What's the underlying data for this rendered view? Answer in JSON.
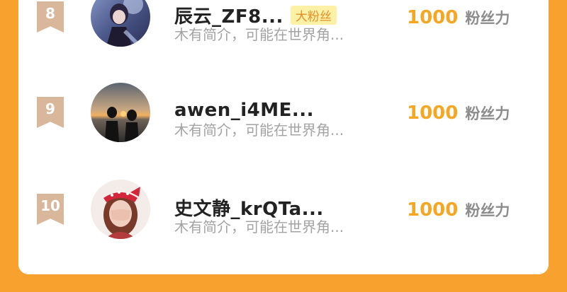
{
  "rows": [
    {
      "rank": "8",
      "name": "辰云_ZF8...",
      "badge": "大粉丝",
      "desc": "木有简介，可能在世界角...",
      "count": "1000",
      "unit": "粉丝力",
      "avatar": "anime-character-avatar"
    },
    {
      "rank": "9",
      "name": "awen_i4ME...",
      "badge": "",
      "desc": "木有简介，可能在世界角...",
      "count": "1000",
      "unit": "粉丝力",
      "avatar": "sunset-couple-avatar"
    },
    {
      "rank": "10",
      "name": "史文静_krQTa...",
      "badge": "",
      "desc": "木有简介，可能在世界角...",
      "count": "1000",
      "unit": "粉丝力",
      "avatar": "girl-red-bow-avatar"
    }
  ],
  "colors": {
    "background": "#f9a12e",
    "rank_ribbon": "#d9b79b",
    "count": "#f5a623",
    "badge_bg": "#fdf1a5",
    "badge_text": "#e2902a"
  }
}
